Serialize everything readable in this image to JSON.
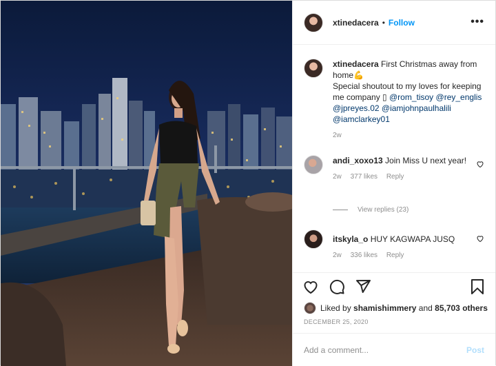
{
  "post": {
    "author": "xtinedacera",
    "follow_label": "Follow",
    "separator": "•",
    "more_label": "•••"
  },
  "caption": {
    "author": "xtinedacera",
    "text_line1": "First Christmas away from home",
    "emoji": "💪",
    "text_line2": "Special shoutout to my loves for keeping me company",
    "mentions": [
      "@rom_tisoy",
      "@rey_englis",
      "@jpreyes.02",
      "@iamjohnpaulhalili",
      "@iamclarkey01"
    ],
    "age": "2w"
  },
  "comments": [
    {
      "author": "andi_xoxo13",
      "text": "Join Miss U next year!",
      "age": "2w",
      "likes": "377 likes",
      "reply_label": "Reply"
    },
    {
      "author": "itskyla_o",
      "text": "HUY KAGWAPA JUSQ",
      "age": "2w",
      "likes": "336 likes",
      "reply_label": "Reply"
    }
  ],
  "view_replies": "View replies (23)",
  "likes": {
    "prefix": "Liked by",
    "user": "shamishimmery",
    "middle": "and",
    "count": "85,703 others"
  },
  "date": "DECEMBER 25, 2020",
  "add_comment": {
    "placeholder": "Add a comment...",
    "post_label": "Post"
  },
  "icons": [
    "heart-icon",
    "comment-icon",
    "share-icon",
    "bookmark-icon",
    "more-icon"
  ]
}
